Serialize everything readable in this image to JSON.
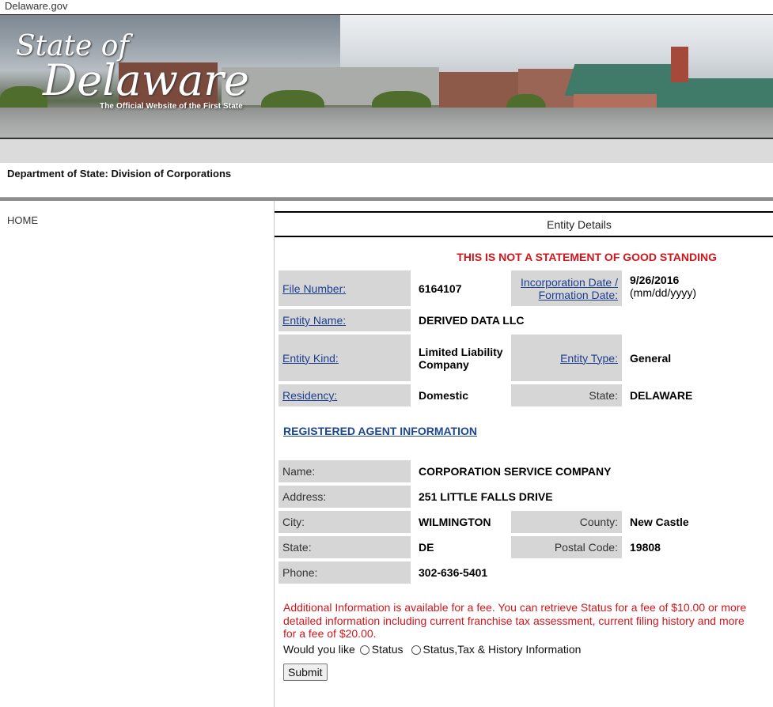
{
  "topbar": {
    "site_name": "Delaware.gov"
  },
  "banner": {
    "logo_line1": "State of",
    "logo_line2": "Delaware",
    "tagline": "The Official Website of the First State"
  },
  "department": "Department of State: Division of Corporations",
  "sidebar": {
    "home_label": "HOME"
  },
  "main": {
    "title": "Entity Details",
    "warning": "THIS IS NOT A STATEMENT OF GOOD STANDING",
    "entity": {
      "file_number_label": "File Number:",
      "file_number": "6164107",
      "incorporation_label_line1": "Incorporation Date /",
      "incorporation_label_line2": "Formation Date:",
      "incorporation_date": "9/26/2016",
      "date_format": "(mm/dd/yyyy)",
      "entity_name_label": "Entity Name:",
      "entity_name": "DERIVED DATA LLC",
      "entity_kind_label": "Entity Kind:",
      "entity_kind": "Limited Liability Company",
      "entity_type_label": "Entity Type:",
      "entity_type": "General",
      "residency_label": "Residency:",
      "residency": "Domestic",
      "state_label": "State:",
      "state": "DELAWARE"
    },
    "registered_agent": {
      "header": "REGISTERED AGENT INFORMATION",
      "name_label": "Name:",
      "name": "CORPORATION SERVICE COMPANY",
      "address_label": "Address:",
      "address": "251 LITTLE FALLS DRIVE",
      "city_label": "City:",
      "city": "WILMINGTON",
      "county_label": "County:",
      "county": "New Castle",
      "state_label": "State:",
      "state": "DE",
      "postal_label": "Postal Code:",
      "postal_code": "19808",
      "phone_label": "Phone:",
      "phone": "302-636-5401"
    },
    "fee_notice": "Additional Information is available for a fee. You can retrieve Status for a fee of $10.00 or more detailed information including current franchise tax assessment, current filing history and more for a fee of $20.00.",
    "would_you_like": "Would you like",
    "options": [
      {
        "label": "Status",
        "selected": false
      },
      {
        "label": "Status,Tax & History Information",
        "selected": false
      }
    ],
    "submit_label": "Submit"
  },
  "colors": {
    "warning_red": "#d0161c",
    "link_blue": "#1d3f8f",
    "label_grey": "#d6d6d6"
  }
}
